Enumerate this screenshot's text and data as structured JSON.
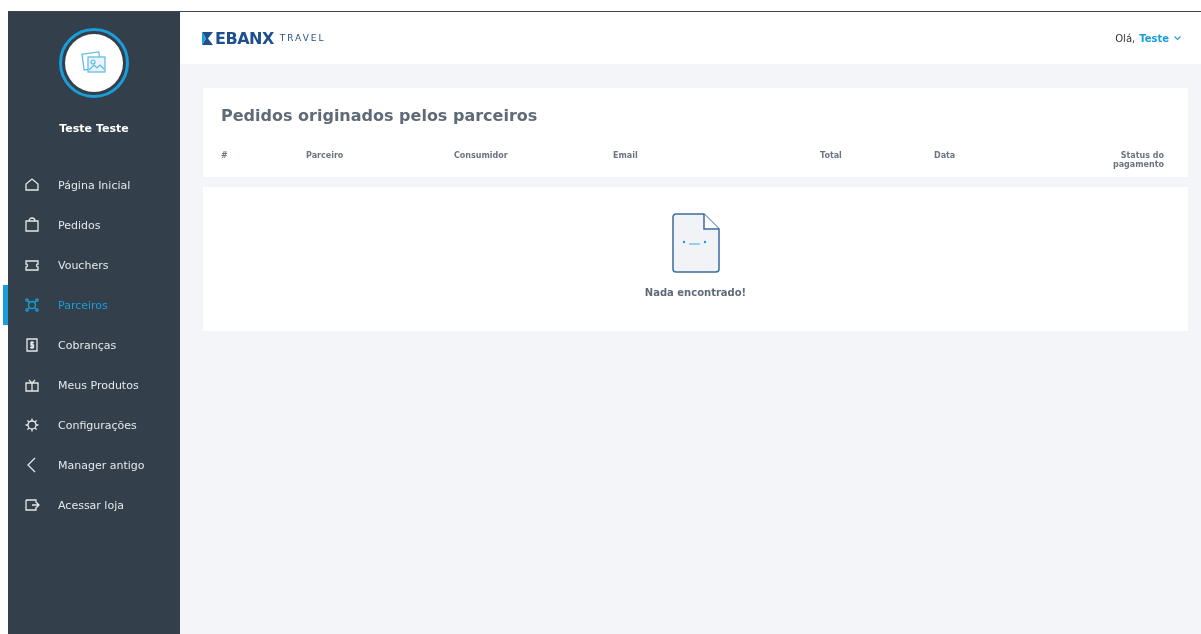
{
  "sidebar": {
    "user_name": "Teste Teste",
    "items": [
      {
        "label": "Página Inicial",
        "selected": false
      },
      {
        "label": "Pedidos",
        "selected": false
      },
      {
        "label": "Vouchers",
        "selected": false
      },
      {
        "label": "Parceiros",
        "selected": true
      },
      {
        "label": "Cobranças",
        "selected": false
      },
      {
        "label": "Meus Produtos",
        "selected": false
      },
      {
        "label": "Configurações",
        "selected": false
      },
      {
        "label": "Manager antigo",
        "selected": false
      },
      {
        "label": "Acessar loja",
        "selected": false
      }
    ]
  },
  "header": {
    "logo": "EBANX",
    "logo_suffix": "TRAVEL",
    "greeting": "Olá,",
    "user": "Teste"
  },
  "page": {
    "title": "Pedidos originados pelos parceiros",
    "table": {
      "columns": [
        "#",
        "Parceiro",
        "Consumidor",
        "Email",
        "Total",
        "Data",
        "Status do pagamento"
      ]
    },
    "empty_message": "Nada encontrado!"
  }
}
